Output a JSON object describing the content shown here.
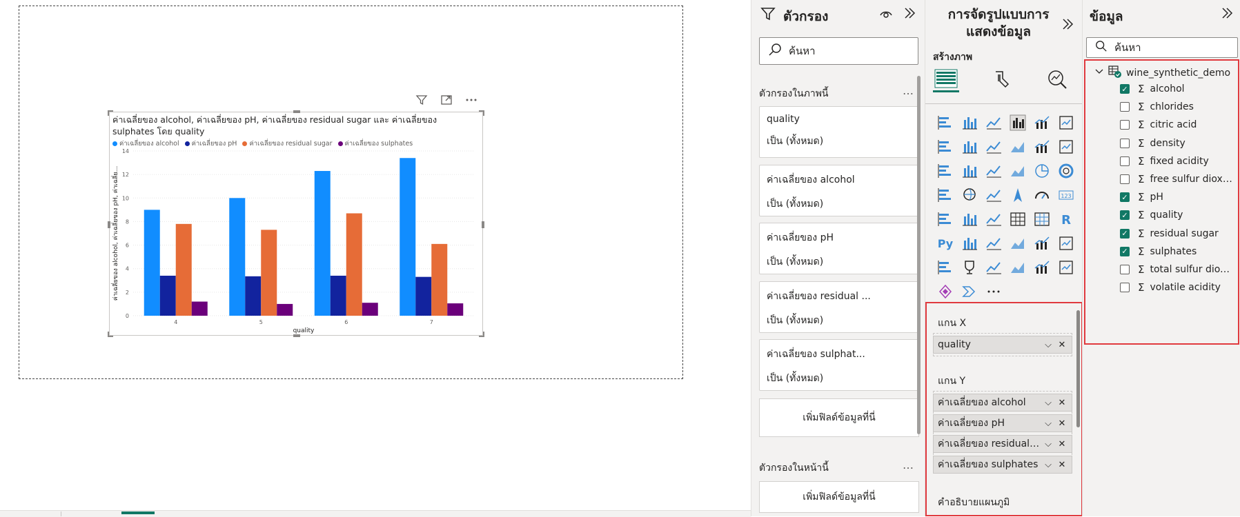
{
  "colors": {
    "accent": "#117865",
    "series": [
      "#118DFF",
      "#12239E",
      "#E66C37",
      "#6B007B"
    ],
    "highlight_border": "#e0393e"
  },
  "visual_header": {
    "filter_icon": "filter-icon",
    "focus_icon": "focus-mode-icon",
    "more_icon": "more-options-icon"
  },
  "chart_data": {
    "type": "bar",
    "title": "ค่าเฉลี่ยของ alcohol, ค่าเฉลี่ยของ pH, ค่าเฉลี่ยของ residual sugar และ ค่าเฉลี่ยของ sulphates โดย quality",
    "categories": [
      "4",
      "5",
      "6",
      "7"
    ],
    "series": [
      {
        "name": "ค่าเฉลี่ยของ alcohol",
        "values": [
          9.0,
          10.0,
          12.3,
          13.4
        ]
      },
      {
        "name": "ค่าเฉลี่ยของ pH",
        "values": [
          3.4,
          3.35,
          3.4,
          3.3
        ]
      },
      {
        "name": "ค่าเฉลี่ยของ residual sugar",
        "values": [
          7.8,
          7.3,
          8.7,
          6.1
        ]
      },
      {
        "name": "ค่าเฉลี่ยของ sulphates",
        "values": [
          1.2,
          1.0,
          1.1,
          1.05
        ]
      }
    ],
    "xlabel": "quality",
    "ylabel": "ค่าเฉลี่ยของ alcohol, ค่าเฉลี่ยของ pH, ค่าเฉลี่ย...",
    "ylim": [
      0,
      14
    ],
    "yticks": [
      "0",
      "2",
      "4",
      "6",
      "8",
      "10",
      "12",
      "14"
    ],
    "grid": true,
    "legend_position": "top-left"
  },
  "filters": {
    "title": "ตัวกรอง",
    "search_placeholder": "ค้นหา",
    "visual_section": "ตัวกรองในภาพนี้",
    "more": "…",
    "cards": [
      {
        "name": "quality",
        "value": "เป็น (ทั้งหมด)"
      },
      {
        "name": "ค่าเฉลี่ยของ alcohol",
        "value": "เป็น (ทั้งหมด)"
      },
      {
        "name": "ค่าเฉลี่ยของ pH",
        "value": "เป็น (ทั้งหมด)"
      },
      {
        "name": "ค่าเฉลี่ยของ residual ...",
        "value": "เป็น (ทั้งหมด)"
      },
      {
        "name": "ค่าเฉลี่ยของ sulphat...",
        "value": "เป็น (ทั้งหมด)"
      }
    ],
    "add_field": "เพิ่มฟิลด์ข้อมูลที่นี่",
    "page_section": "ตัวกรองในหน้านี้",
    "page_add_field": "เพิ่มฟิลด์ข้อมูลที่นี่"
  },
  "viz": {
    "title_line1": "การจัดรูปแบบการ",
    "title_line2": "แสดงข้อมูล",
    "build_label": "สร้างภาพ",
    "more_visuals": "…",
    "x_axis_label": "แกน X",
    "x_axis_field": "quality",
    "y_axis_label": "แกน Y",
    "y_fields": [
      "ค่าเฉลี่ยของ alcohol",
      "ค่าเฉลี่ยของ pH",
      "ค่าเฉลี่ยของ residual s...",
      "ค่าเฉลี่ยของ sulphates"
    ],
    "legend_label": "คำอธิบายแผนภูมิ"
  },
  "data": {
    "title": "ข้อมูล",
    "search_placeholder": "ค้นหา",
    "table_name": "wine_synthetic_demo",
    "fields": [
      {
        "name": "alcohol",
        "checked": true
      },
      {
        "name": "chlorides",
        "checked": false
      },
      {
        "name": "citric acid",
        "checked": false
      },
      {
        "name": "density",
        "checked": false
      },
      {
        "name": "fixed acidity",
        "checked": false
      },
      {
        "name": "free sulfur dioxide",
        "checked": false
      },
      {
        "name": "pH",
        "checked": true
      },
      {
        "name": "quality",
        "checked": true
      },
      {
        "name": "residual sugar",
        "checked": true
      },
      {
        "name": "sulphates",
        "checked": true
      },
      {
        "name": "total sulfur dioxi...",
        "checked": false
      },
      {
        "name": "volatile acidity",
        "checked": false
      }
    ]
  }
}
